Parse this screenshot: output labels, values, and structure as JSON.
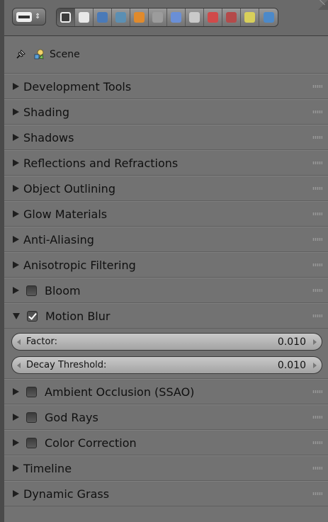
{
  "header": {
    "tabs": [
      {
        "name": "render-tab-icon",
        "color": "#3c3c3c",
        "active": true
      },
      {
        "name": "render-layers-tab-icon",
        "color": "#e8e8e8",
        "active": false
      },
      {
        "name": "scene-tab-icon",
        "color": "#4a7ab8",
        "active": false
      },
      {
        "name": "world-tab-icon",
        "color": "#5b8fb3",
        "active": false
      },
      {
        "name": "object-tab-icon",
        "color": "#e08a2c",
        "active": false
      },
      {
        "name": "constraints-tab-icon",
        "color": "#9c9c9c",
        "active": false
      },
      {
        "name": "modifiers-tab-icon",
        "color": "#6a8fd6",
        "active": false
      },
      {
        "name": "data-tab-icon",
        "color": "#c9c9c9",
        "active": false
      },
      {
        "name": "material-tab-icon",
        "color": "#d04a4a",
        "active": false
      },
      {
        "name": "texture-tab-icon",
        "color": "#b44a4a",
        "active": false
      },
      {
        "name": "particles-tab-icon",
        "color": "#d8cf5a",
        "active": false
      },
      {
        "name": "physics-tab-icon",
        "color": "#4c89c9",
        "active": false
      }
    ]
  },
  "context": {
    "scene_label": "Scene"
  },
  "panels_top": [
    {
      "title": "Development Tools",
      "expanded": false,
      "checkbox": null
    },
    {
      "title": "Shading",
      "expanded": false,
      "checkbox": null
    },
    {
      "title": "Shadows",
      "expanded": false,
      "checkbox": null
    },
    {
      "title": "Reflections and Refractions",
      "expanded": false,
      "checkbox": null
    },
    {
      "title": "Object Outlining",
      "expanded": false,
      "checkbox": null
    },
    {
      "title": "Glow Materials",
      "expanded": false,
      "checkbox": null
    },
    {
      "title": "Anti-Aliasing",
      "expanded": false,
      "checkbox": null
    },
    {
      "title": "Anisotropic Filtering",
      "expanded": false,
      "checkbox": null
    },
    {
      "title": "Bloom",
      "expanded": false,
      "checkbox": false
    },
    {
      "title": "Motion Blur",
      "expanded": true,
      "checkbox": true
    }
  ],
  "motion_blur": {
    "factor_label": "Factor:",
    "factor_value": "0.010",
    "decay_label": "Decay Threshold:",
    "decay_value": "0.010"
  },
  "panels_bottom": [
    {
      "title": "Ambient Occlusion (SSAO)",
      "expanded": false,
      "checkbox": false
    },
    {
      "title": "God Rays",
      "expanded": false,
      "checkbox": false
    },
    {
      "title": "Color Correction",
      "expanded": false,
      "checkbox": false
    },
    {
      "title": "Timeline",
      "expanded": false,
      "checkbox": null
    },
    {
      "title": "Dynamic Grass",
      "expanded": false,
      "checkbox": null
    }
  ]
}
